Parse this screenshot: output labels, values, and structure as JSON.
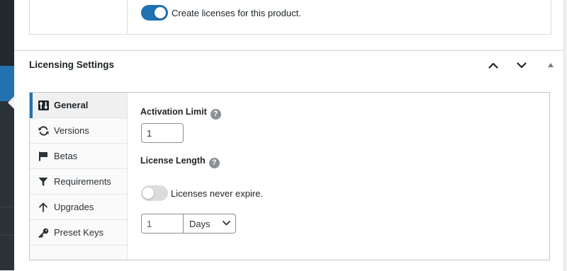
{
  "product_licensing": {
    "create_licenses_label": "Create licenses for this product.",
    "create_licenses_enabled": true
  },
  "metabox": {
    "title": "Licensing Settings",
    "move_up_icon": "chevron-up-icon",
    "move_down_icon": "chevron-down-icon",
    "toggle_icon": "triangle-up-icon"
  },
  "tabs": [
    {
      "label": "General",
      "icon": "sliders-icon",
      "active": true
    },
    {
      "label": "Versions",
      "icon": "refresh-icon",
      "active": false
    },
    {
      "label": "Betas",
      "icon": "flag-icon",
      "active": false
    },
    {
      "label": "Requirements",
      "icon": "filter-icon",
      "active": false
    },
    {
      "label": "Upgrades",
      "icon": "arrow-up-icon",
      "active": false
    },
    {
      "label": "Preset Keys",
      "icon": "key-icon",
      "active": false
    }
  ],
  "general": {
    "activation_limit_label": "Activation Limit",
    "activation_limit_value": "1",
    "help_glyph": "?",
    "license_length_label": "License Length",
    "never_expire_label": "Licenses never expire.",
    "never_expire_enabled": false,
    "length_value": "1",
    "length_unit": "Days"
  },
  "colors": {
    "accent": "#2271b1",
    "sidebar": "#1d2327"
  }
}
